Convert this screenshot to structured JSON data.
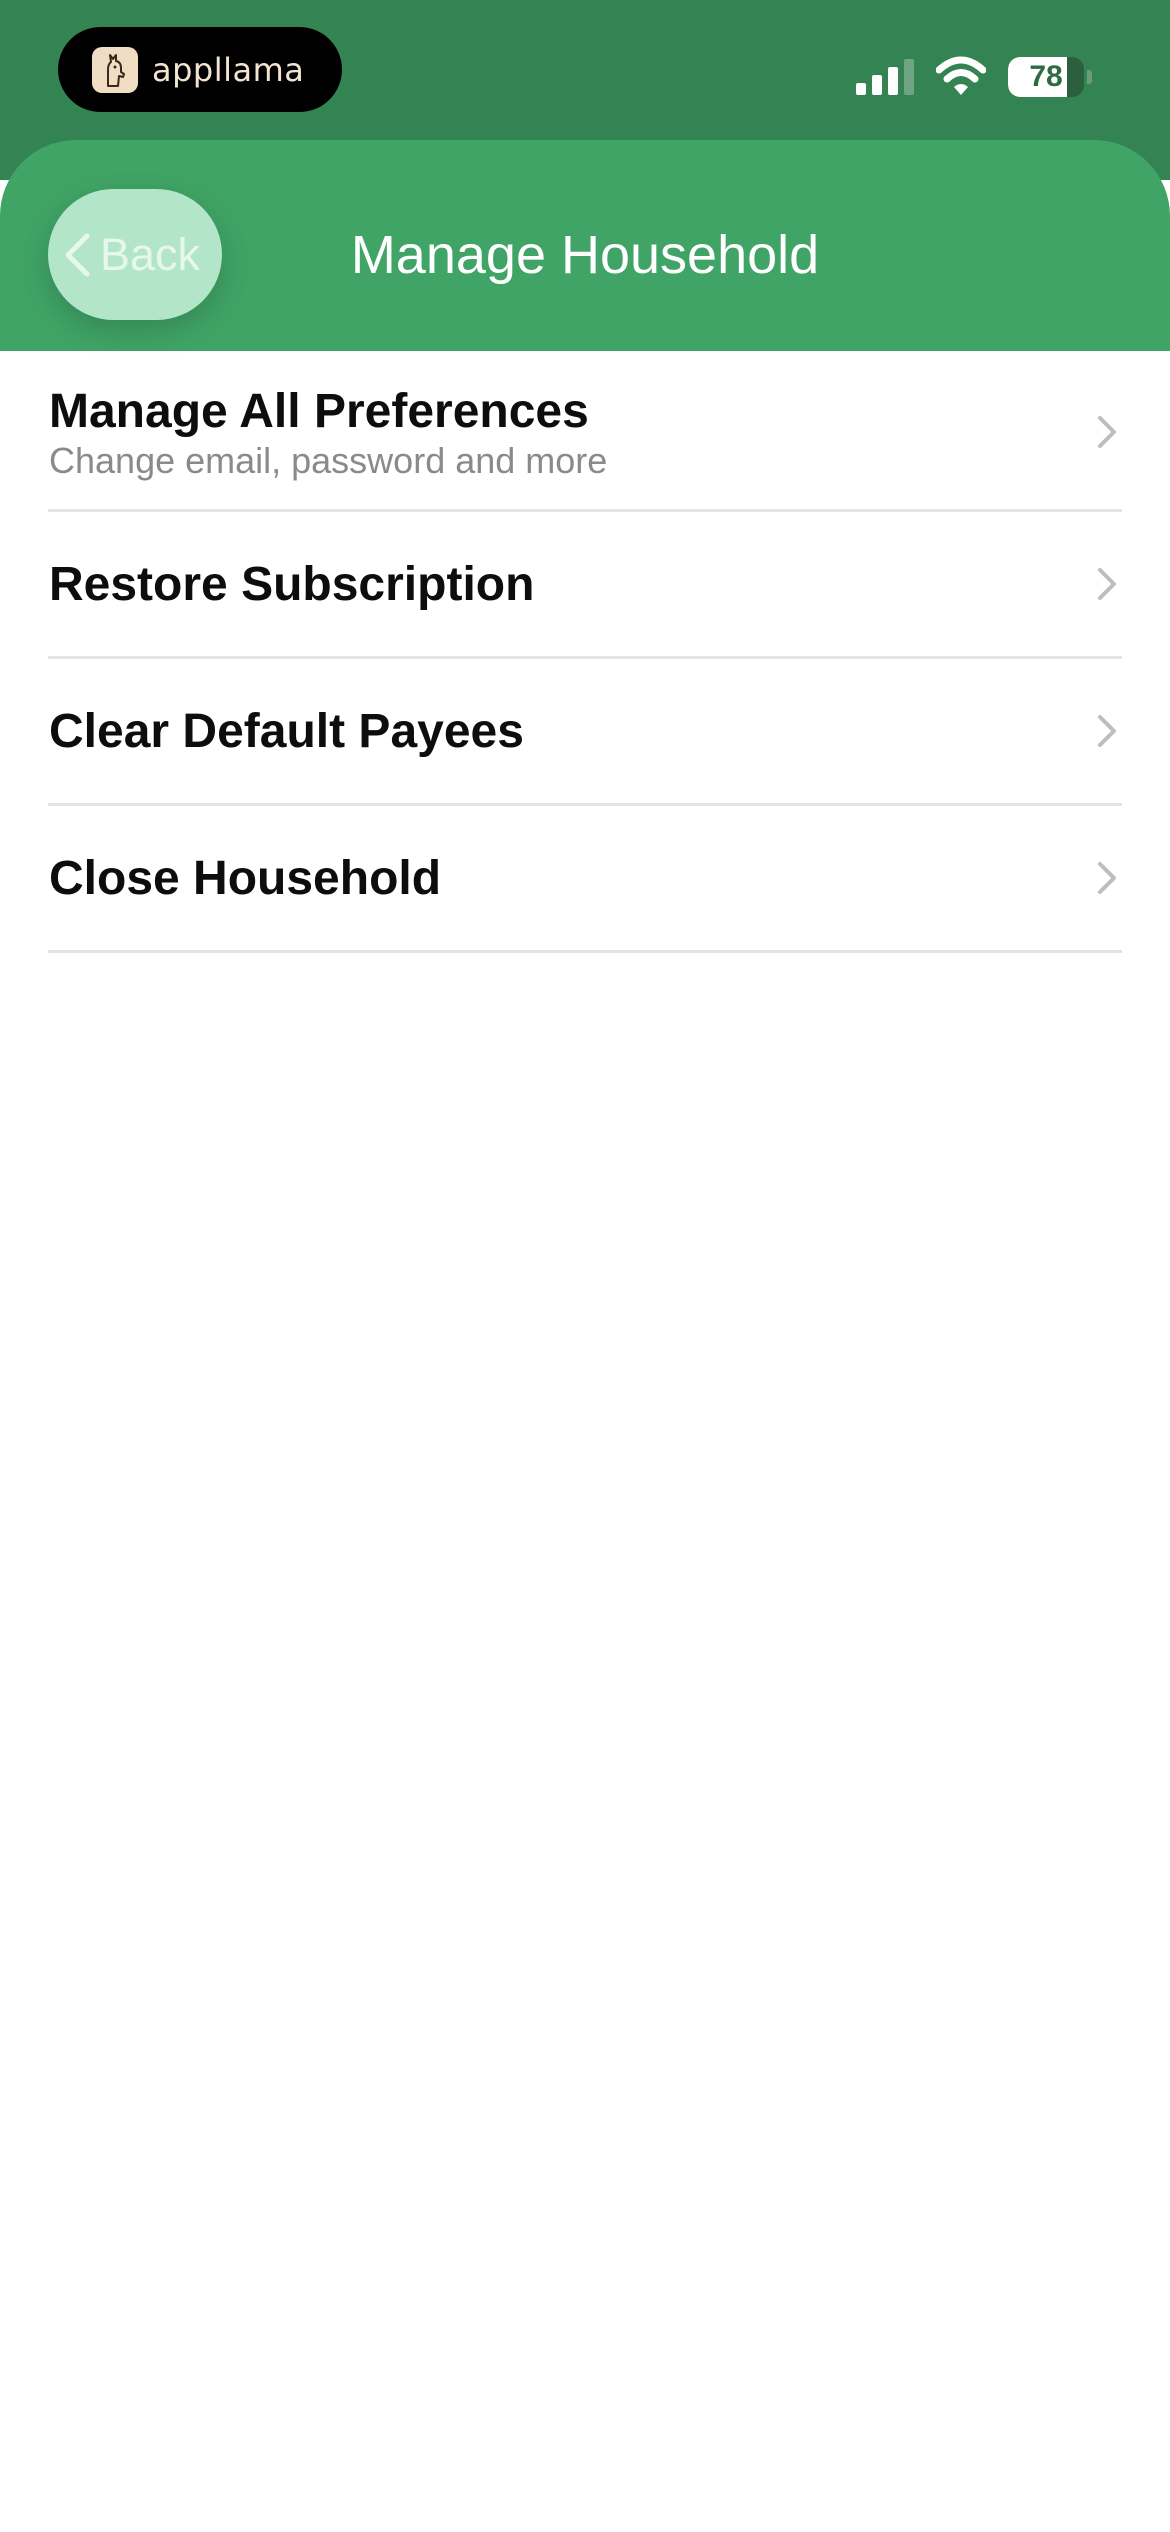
{
  "status_bar": {
    "app_name": "appllama",
    "battery_level": 78,
    "battery_text": "78",
    "colors": {
      "background": "#338452"
    }
  },
  "nav": {
    "back_label": "Back",
    "title": "Manage Household",
    "colors": {
      "background": "#40a466",
      "back_button": "#b3e5c8"
    }
  },
  "menu": {
    "items": [
      {
        "title": "Manage All Preferences",
        "subtitle": "Change email, password and more"
      },
      {
        "title": "Restore Subscription"
      },
      {
        "title": "Clear Default Payees"
      },
      {
        "title": "Close Household"
      }
    ]
  },
  "icons": {
    "app_logo": "llama-icon",
    "signal": "cellular-signal-icon",
    "wifi": "wifi-icon",
    "battery": "battery-icon",
    "back": "chevron-left-icon",
    "row": "chevron-right-icon"
  }
}
